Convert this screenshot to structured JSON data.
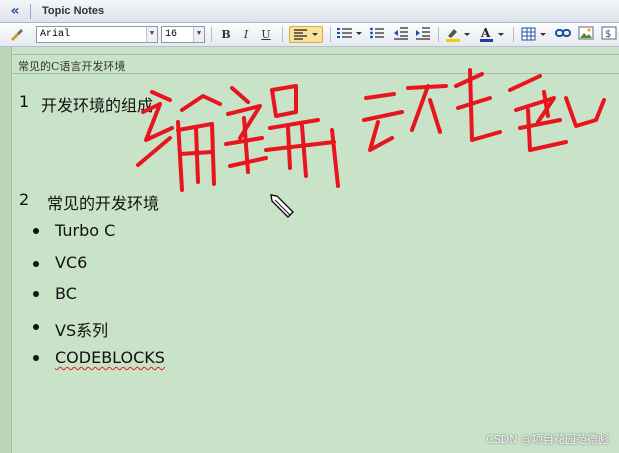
{
  "panel": {
    "title": "Topic Notes",
    "collapse_icon": "«"
  },
  "toolbar": {
    "font_name": "Arial",
    "font_size": "16",
    "bold_label": "B",
    "italic_label": "I",
    "underline_label": "U"
  },
  "editor": {
    "topic_title": "常见的C语言开发环境",
    "heading1_num": "1",
    "heading1_text": "开发环境的组成",
    "heading2_num": "2",
    "heading2_text": "常见的开发环境",
    "bullets": [
      "Turbo C",
      "VC6",
      "BC",
      "VS系列",
      "CODEBLOCKS"
    ],
    "handwriting": "编辑环境"
  },
  "watermark": "CSDN @项目花园范德彪",
  "colors": {
    "background": "#c9e3c8",
    "ink": "#e8141e",
    "title_accent": "#1c4fa0"
  }
}
